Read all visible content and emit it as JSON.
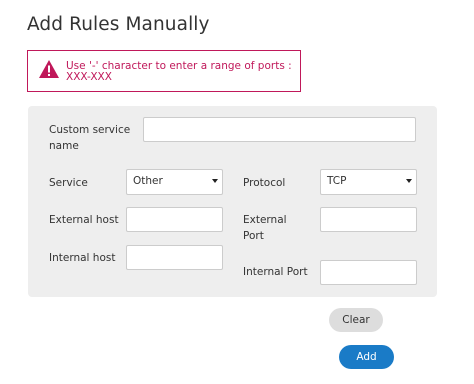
{
  "page": {
    "title": "Add Rules Manually"
  },
  "alert": {
    "icon": "warning-triangle-icon",
    "message": "Use '-' character to enter a range of ports : XXX-XXX",
    "color": "#c0185a"
  },
  "form": {
    "custom_service_name": {
      "label": "Custom service name",
      "value": ""
    },
    "service": {
      "label": "Service",
      "selected": "Other"
    },
    "protocol": {
      "label": "Protocol",
      "selected": "TCP"
    },
    "external_host": {
      "label": "External host",
      "value": ""
    },
    "external_port": {
      "label": "External Port",
      "value": ""
    },
    "internal_host": {
      "label": "Internal host",
      "value": ""
    },
    "internal_port": {
      "label": "Internal Port",
      "value": ""
    }
  },
  "buttons": {
    "clear": "Clear",
    "add": "Add"
  },
  "colors": {
    "accent": "#1a7bc7",
    "panel_bg": "#eeeeee",
    "error": "#c0185a"
  }
}
